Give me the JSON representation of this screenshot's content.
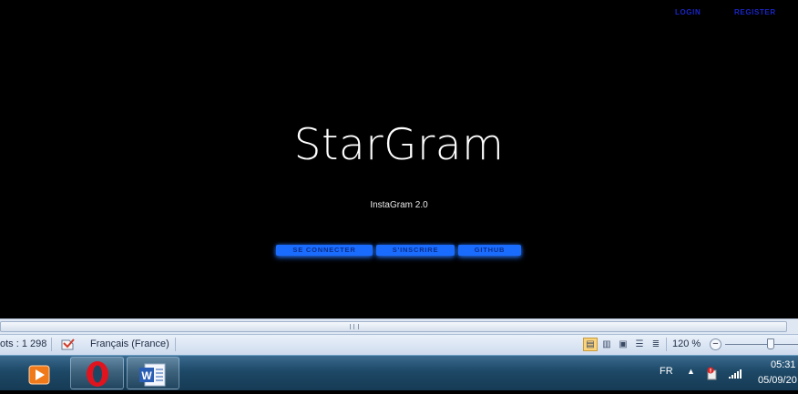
{
  "page": {
    "nav": {
      "login": "LOGIN",
      "register": "REGISTER"
    },
    "hero": {
      "title": "StarGram",
      "subtitle": "InstaGram 2.0"
    },
    "buttons": {
      "connect": "SE CONNECTER",
      "signup": "S'INSCRIRE",
      "github": "GITHUB"
    }
  },
  "word_statusbar": {
    "word_count": "ots : 1 298",
    "language": "Français (France)",
    "zoom": "120 %"
  },
  "taskbar": {
    "apps": [
      "media-player",
      "opera",
      "word"
    ],
    "language": "FR",
    "time": "05:31",
    "date": "05/09/20"
  },
  "colors": {
    "accent_button": "#1a6cff",
    "nav_link": "#1a25c8",
    "page_bg": "#000000",
    "active_view": "#fbd37a"
  }
}
